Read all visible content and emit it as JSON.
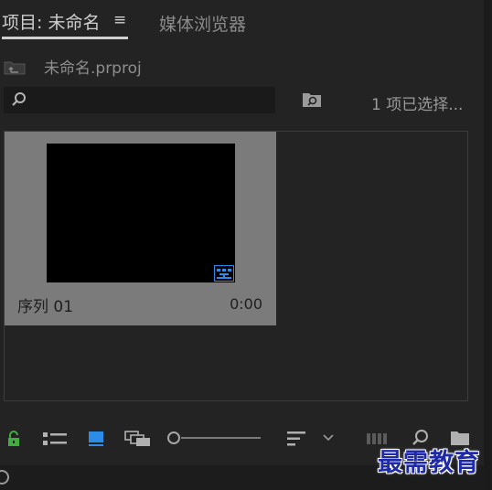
{
  "tabs": {
    "active_label": "项目: 未命名",
    "menu_glyph": "≡",
    "other_label": "媒体浏览器"
  },
  "path": {
    "project_file": "未命名.prproj"
  },
  "search": {
    "placeholder": ""
  },
  "selection_status": "1 项已选择...",
  "items": [
    {
      "name": "序列 01",
      "duration": "0:00"
    }
  ],
  "toolbar": {
    "zoom_level": 0.0
  },
  "colors": {
    "lock_green": "#3fae3f",
    "accent_blue": "#2b8de8",
    "card_bg": "#7b7b7b"
  },
  "watermark": "最需教育",
  "icons": [
    "folder-up-icon",
    "search-icon",
    "bin-search-icon",
    "sequence-icon",
    "lock-icon",
    "list-view-icon",
    "icon-view-icon",
    "freeform-view-icon",
    "zoom-slider",
    "sort-icon",
    "chevron-down-icon",
    "automate-icon",
    "find-icon",
    "new-bin-icon"
  ]
}
